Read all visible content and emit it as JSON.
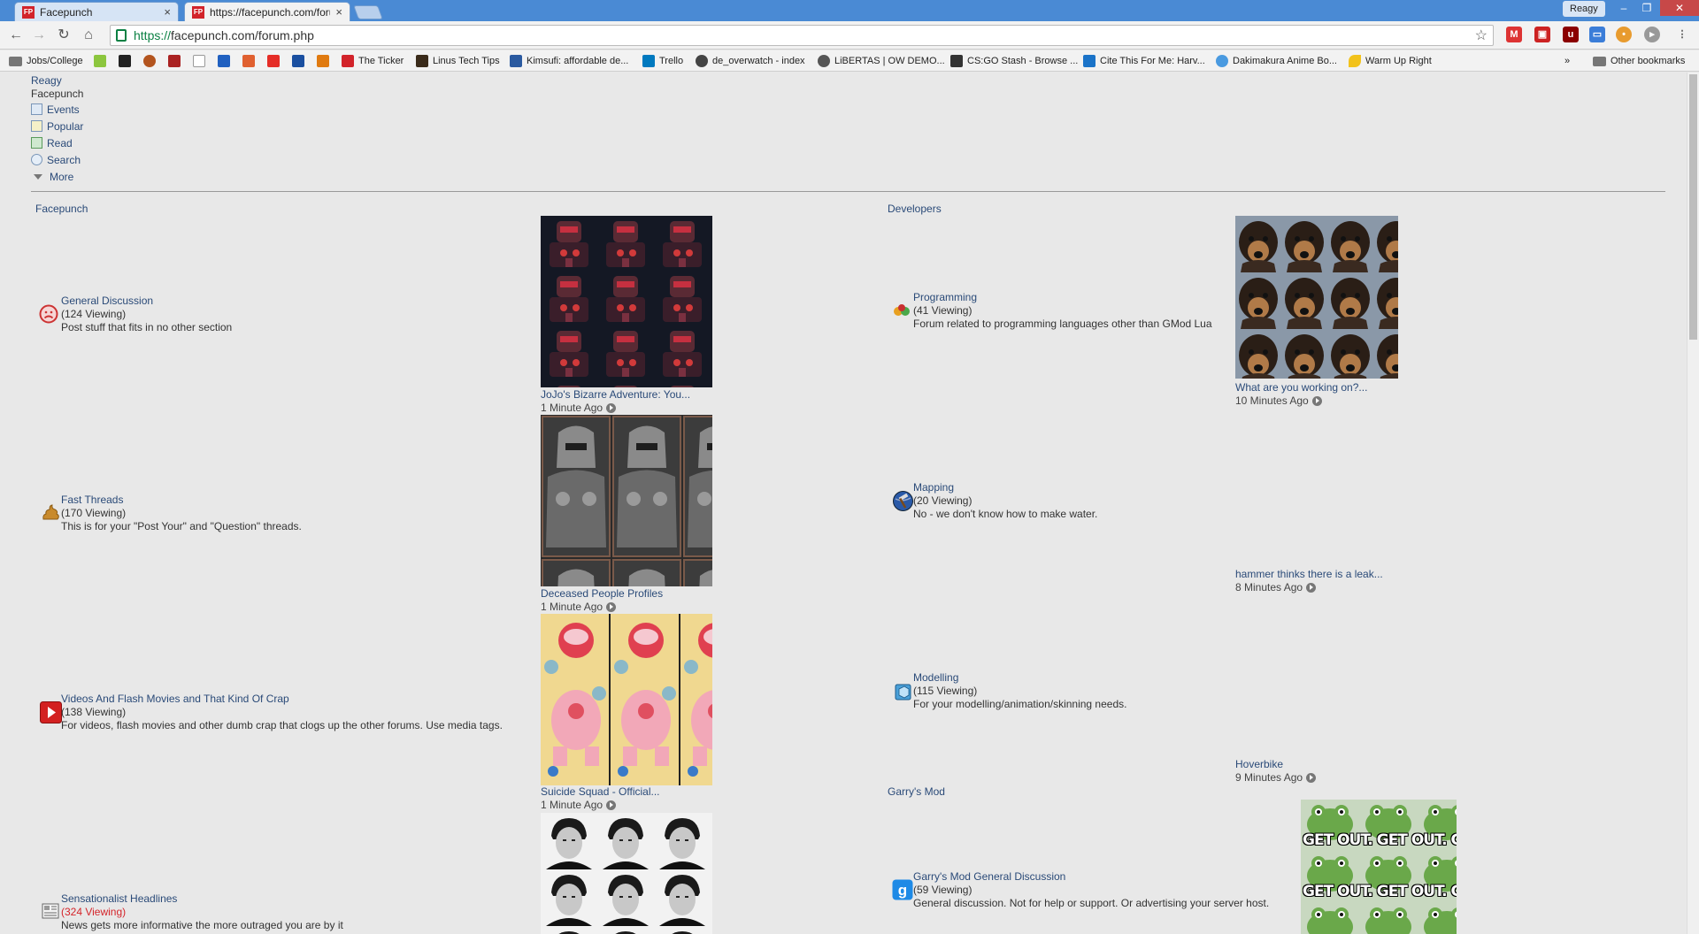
{
  "browser": {
    "tabs": [
      {
        "label": "Facepunch",
        "favicon": "FP"
      },
      {
        "label": "https://facepunch.com/forum",
        "favicon": "FP"
      }
    ],
    "profile_name": "Reagy",
    "url_scheme": "https://",
    "url_rest": "facepunch.com/forum.php",
    "bookmarks": [
      {
        "label": "Jobs/College",
        "icon": "folder-icon"
      },
      {
        "label": "",
        "icon": "recycle-icon"
      },
      {
        "label": "",
        "icon": "news-icon"
      },
      {
        "label": "",
        "icon": "tf2-icon"
      },
      {
        "label": "",
        "icon": "game-icon"
      },
      {
        "label": "",
        "icon": "amazon-icon"
      },
      {
        "label": "",
        "icon": "shoe-icon"
      },
      {
        "label": "",
        "icon": "leaf-icon"
      },
      {
        "label": "",
        "icon": "youtube-icon"
      },
      {
        "label": "",
        "icon": "chart-icon"
      },
      {
        "label": "",
        "icon": "fire-icon"
      },
      {
        "label": "The Ticker",
        "icon": "ticker-icon"
      },
      {
        "label": "Linus Tech Tips",
        "icon": "ltt-icon"
      },
      {
        "label": "Kimsufi: affordable de...",
        "icon": "kimsufi-icon"
      },
      {
        "label": "Trello",
        "icon": "trello-icon"
      },
      {
        "label": "de_overwatch - index",
        "icon": "globe-icon"
      },
      {
        "label": "LiBERTAS | OW DEMO...",
        "icon": "radiation-icon"
      },
      {
        "label": "CS:GO Stash - Browse ...",
        "icon": "gun-icon"
      },
      {
        "label": "Cite This For Me: Harv...",
        "icon": "cite-icon"
      },
      {
        "label": "Dakimakura Anime Bo...",
        "icon": "chrome-icon"
      },
      {
        "label": "Warm Up Right",
        "icon": "banana-icon"
      }
    ],
    "other_bookmarks": "Other bookmarks",
    "overflow": "»"
  },
  "nav": {
    "user": "Reagy",
    "site": "Facepunch",
    "items": [
      {
        "label": "Events",
        "icon": "calendar-icon"
      },
      {
        "label": "Popular",
        "icon": "chart-icon"
      },
      {
        "label": "Read",
        "icon": "read-arrow-icon"
      },
      {
        "label": "Search",
        "icon": "magnifier-icon"
      },
      {
        "label": "More",
        "icon": "triangle-down-icon"
      }
    ]
  },
  "sections": {
    "left": "Facepunch",
    "right": "Developers",
    "right2": "Garry's Mod"
  },
  "forums_left": [
    {
      "title": "General Discussion",
      "viewing": "(124 Viewing)",
      "desc": "Post stuff that fits in no other section",
      "icon": "sad-face-icon",
      "hot": false,
      "last": {
        "title": "JoJo's Bizarre Adventure: You...",
        "time": "1 Minute Ago"
      }
    },
    {
      "title": "Fast Threads",
      "viewing": "(170 Viewing)",
      "desc": "This is for your \"Post Your\" and \"Question\" threads.",
      "icon": "poop-icon",
      "hot": false,
      "last": {
        "title": "Deceased People Profiles",
        "time": "1 Minute Ago"
      }
    },
    {
      "title": "Videos And Flash Movies and That Kind Of Crap",
      "viewing": "(138 Viewing)",
      "desc": "For videos, flash movies and other dumb crap that clogs up the other forums. Use media tags.",
      "icon": "play-icon",
      "hot": false,
      "last": {
        "title": "Suicide Squad - Official...",
        "time": "1 Minute Ago"
      }
    },
    {
      "title": "Sensationalist Headlines",
      "viewing": "(324 Viewing)",
      "desc": "News gets more informative the more outraged you are by it",
      "icon": "newspaper-icon",
      "hot": true,
      "last": {
        "title": "",
        "time": ""
      }
    }
  ],
  "forums_right": [
    {
      "title": "Programming",
      "viewing": "(41 Viewing)",
      "desc": "Forum related to programming languages other than GMod Lua",
      "icon": "code-icon",
      "last": {
        "title": "What are you working on?...",
        "time": "10 Minutes Ago"
      }
    },
    {
      "title": "Mapping",
      "viewing": "(20 Viewing)",
      "desc": "No - we don't know how to make water.",
      "icon": "hammer-globe-icon",
      "last": {
        "title": "hammer thinks there is a leak...",
        "time": "8 Minutes Ago"
      }
    },
    {
      "title": "Modelling",
      "viewing": "(115 Viewing)",
      "desc": "For your modelling/animation/skinning needs.",
      "icon": "cube-icon",
      "last": {
        "title": "Hoverbike",
        "time": "9 Minutes Ago"
      }
    },
    {
      "title": "Garry's Mod General Discussion",
      "viewing": "(59 Viewing)",
      "desc": "General discussion. Not for help or support. Or advertising your server host.",
      "icon": "gmod-icon",
      "last": {
        "title": "",
        "time": ""
      }
    }
  ],
  "avatar_text": {
    "frog": "GET OUT."
  },
  "colors": {
    "link": "#2a4a78",
    "hot": "#d4242a",
    "background": "#e8e8e8",
    "tabbar": "#4a8ad4"
  }
}
